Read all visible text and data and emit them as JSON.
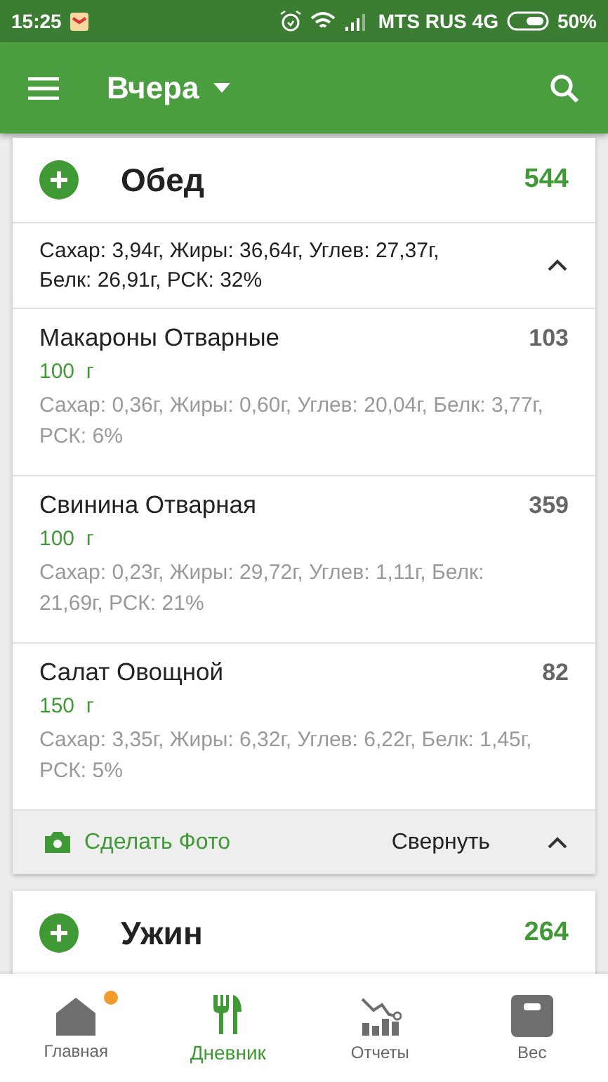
{
  "status_bar": {
    "time": "15:25",
    "carrier": "MTS RUS 4G",
    "battery": "50%"
  },
  "app_bar": {
    "title": "Вчера"
  },
  "meals": [
    {
      "name": "Обед",
      "calories": "544",
      "summary": "Сахар: 3,94г, Жиры: 36,64г, Углев: 27,37г, Белк: 26,91г, РСК: 32%",
      "items": [
        {
          "name": "Макароны Отварные",
          "amount": "100  г",
          "calories": "103",
          "details": "Сахар: 0,36г, Жиры: 0,60г, Углев: 20,04г, Белк: 3,77г, РСК: 6%"
        },
        {
          "name": "Свинина Отварная",
          "amount": "100  г",
          "calories": "359",
          "details": "Сахар: 0,23г, Жиры: 29,72г, Углев: 1,11г, Белк: 21,69г, РСК: 21%"
        },
        {
          "name": "Салат Овощной",
          "amount": "150  г",
          "calories": "82",
          "details": "Сахар: 3,35г, Жиры: 6,32г, Углев: 6,22г, Белк: 1,45г, РСК: 5%"
        }
      ],
      "photo_label": "Сделать Фото",
      "collapse_label": "Свернуть"
    },
    {
      "name": "Ужин",
      "calories": "264"
    }
  ],
  "bottom_nav": [
    {
      "label": "Главная",
      "kind": "home",
      "selected": false,
      "badge": true
    },
    {
      "label": "Дневник",
      "kind": "diary",
      "selected": true,
      "badge": false
    },
    {
      "label": "Отчеты",
      "kind": "reports",
      "selected": false,
      "badge": false
    },
    {
      "label": "Вес",
      "kind": "scale",
      "selected": false,
      "badge": false
    }
  ]
}
